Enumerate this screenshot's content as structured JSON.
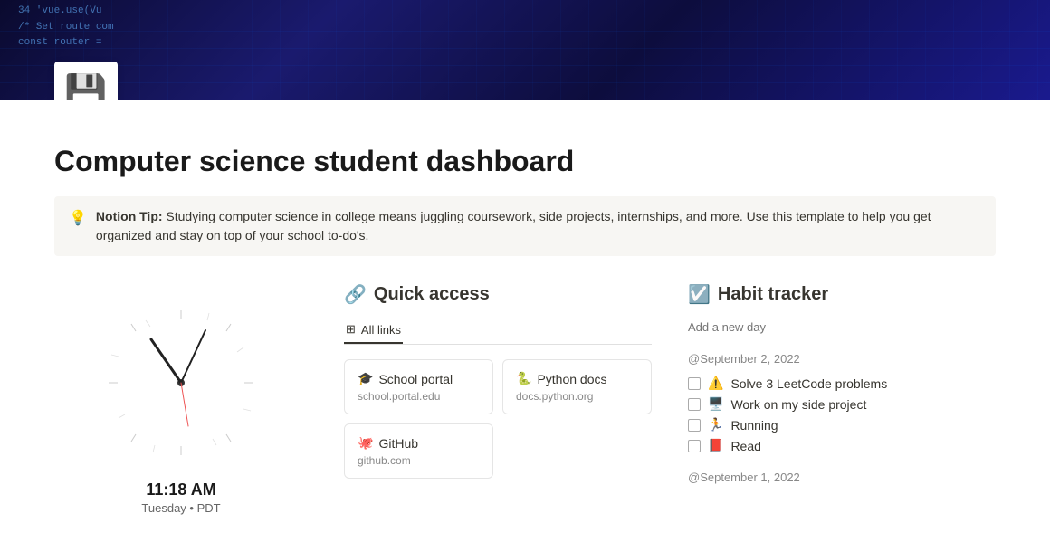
{
  "header": {
    "banner_code_lines": [
      "34   'vue.use(Vu",
      "       /* Set route com",
      "         const router ="
    ]
  },
  "page": {
    "icon": "💾",
    "title": "Computer science student dashboard",
    "callout": {
      "icon": "💡",
      "prefix": "Notion Tip:",
      "text": " Studying computer science in college means juggling coursework, side projects, internships, and more. Use this template to help you get organized and stay on top of your school to-do's."
    }
  },
  "clock": {
    "time": "11:18 AM",
    "date": "Tuesday • PDT"
  },
  "quick_access": {
    "title": "Quick access",
    "title_icon": "🔗",
    "tab_label": "All links",
    "links": [
      {
        "icon": "🎓",
        "title": "School portal",
        "url": "school.portal.edu"
      },
      {
        "icon": "🐍",
        "title": "Python docs",
        "url": "docs.python.org"
      },
      {
        "icon": "🐙",
        "title": "GitHub",
        "url": "github.com"
      }
    ]
  },
  "habit_tracker": {
    "title": "Habit tracker",
    "title_icon": "☑️",
    "add_day_placeholder": "Add a new day",
    "date_groups": [
      {
        "date": "@September 2, 2022",
        "habits": [
          {
            "emoji": "⚠️",
            "label": "Solve 3 LeetCode problems",
            "checked": false
          },
          {
            "emoji": "🖥️",
            "label": "Work on my side project",
            "checked": false
          },
          {
            "emoji": "🏃",
            "label": "Running",
            "checked": false
          },
          {
            "emoji": "📕",
            "label": "Read",
            "checked": false
          }
        ]
      },
      {
        "date": "@September 1, 2022",
        "habits": []
      }
    ]
  }
}
